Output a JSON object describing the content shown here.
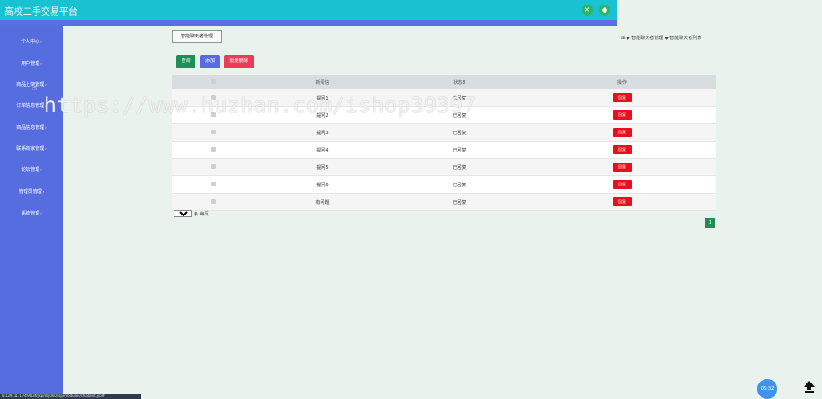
{
  "app": {
    "title": "高校二手交易平台"
  },
  "header_icons": [
    "fullscreen-icon",
    "user-icon"
  ],
  "sidebar": {
    "items": [
      {
        "label": "个人中心"
      },
      {
        "label": "用户管理"
      },
      {
        "label": "商品上架管理"
      },
      {
        "label": "订单信息管理"
      },
      {
        "label": "商品信息管理"
      },
      {
        "label": "联系商家管理"
      },
      {
        "label": "论坛管理"
      },
      {
        "label": "管理员管理"
      },
      {
        "label": "系统管理"
      }
    ]
  },
  "status_url": "8.129.11.174:9036/jspmsj0k0/jsp/modules/chat/list.jsp#",
  "page_tab": "智能聊天者管理",
  "breadcrumb": "⊞ ◆ 智能聊天者管理 ◆ 智能聊天者列表",
  "toolbar": {
    "search": "查询",
    "add": "添加",
    "batch_delete": "批量删除"
  },
  "table": {
    "headers": [
      "",
      "新闻信",
      "状态8",
      "操作"
    ],
    "rows": [
      {
        "question": "提问1",
        "status": "未回复",
        "action": "回复"
      },
      {
        "question": "提问2",
        "status": "已回复",
        "action": "回复"
      },
      {
        "question": "提问3",
        "status": "已回复",
        "action": "回复"
      },
      {
        "question": "提问4",
        "status": "已回复",
        "action": "回复"
      },
      {
        "question": "提问5",
        "status": "已回复",
        "action": "回复"
      },
      {
        "question": "提问6",
        "status": "已回复",
        "action": "回复"
      },
      {
        "question": "有问题",
        "status": "已回复",
        "action": "回复"
      }
    ]
  },
  "pager": {
    "per_page": "10",
    "per_page_label": "条 每页",
    "current_page": "1"
  },
  "watermark": "https://www.huzhan.com/ishop39397",
  "clock": "06:32",
  "colors": {
    "topbar": "#19c2d0",
    "sidebar": "#566de0",
    "reply": "#e8101f",
    "primary": "#1e8f58"
  }
}
